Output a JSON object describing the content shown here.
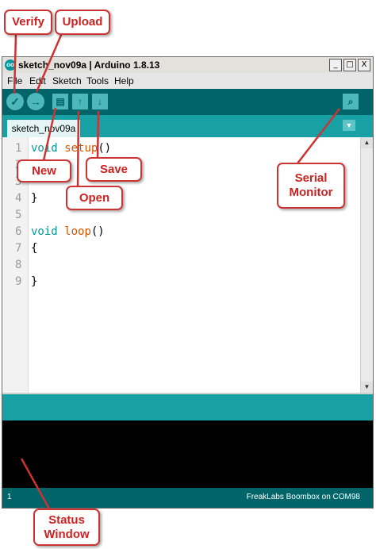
{
  "window": {
    "title": "sketch_nov09a | Arduino 1.8.13",
    "app_icon_text": "oo",
    "controls": [
      "_",
      "□",
      "X"
    ]
  },
  "menu": [
    "File",
    "Edit",
    "Sketch",
    "Tools",
    "Help"
  ],
  "toolbar": {
    "verify_glyph": "✓",
    "upload_glyph": "→",
    "new_glyph": "▤",
    "open_glyph": "↑",
    "save_glyph": "↓",
    "serial_monitor_glyph": "⌕"
  },
  "tab": {
    "name": "sketch_nov09a",
    "menu_glyph": "▼"
  },
  "editor": {
    "lines": [
      {
        "num": "1",
        "kw": "void",
        "fn": "setup",
        "rest": "()"
      },
      {
        "num": "2",
        "kw": "",
        "fn": "",
        "rest": ""
      },
      {
        "num": "3",
        "kw": "",
        "fn": "",
        "rest": ""
      },
      {
        "num": "4",
        "kw": "",
        "fn": "",
        "rest": "}"
      },
      {
        "num": "5",
        "kw": "",
        "fn": "",
        "rest": ""
      },
      {
        "num": "6",
        "kw": "void",
        "fn": "loop",
        "rest": "()"
      },
      {
        "num": "7",
        "kw": "",
        "fn": "",
        "rest": "{"
      },
      {
        "num": "8",
        "kw": "",
        "fn": "",
        "rest": ""
      },
      {
        "num": "9",
        "kw": "",
        "fn": "",
        "rest": "}"
      }
    ],
    "scroll_up": "▲",
    "scroll_down": "▼"
  },
  "status": {
    "line_number": "1",
    "board_port": "FreakLabs Boombox on COM98"
  },
  "callouts": {
    "verify": "Verify",
    "upload": "Upload",
    "new": "New",
    "save": "Save",
    "open": "Open",
    "serial_monitor": "Serial Monitor",
    "status_window": "Status Window"
  },
  "colors": {
    "toolbar": "#006468",
    "tabbar": "#17a1a5",
    "callout_border": "#cc3333",
    "console": "#000000"
  }
}
